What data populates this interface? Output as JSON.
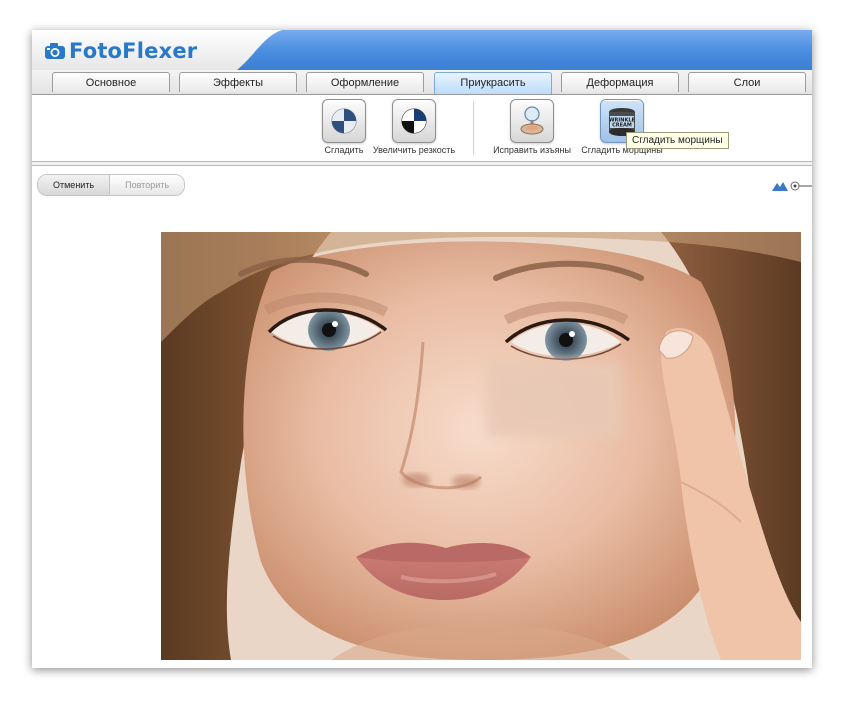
{
  "app": {
    "name": "FotoFlexer"
  },
  "tabs": [
    {
      "label": "Основное"
    },
    {
      "label": "Эффекты"
    },
    {
      "label": "Оформление"
    },
    {
      "label": "Приукрасить",
      "active": true
    },
    {
      "label": "Деформация"
    },
    {
      "label": "Слои"
    }
  ],
  "tools": [
    {
      "label": "Сгладить",
      "icon": "smooth-icon"
    },
    {
      "label": "Увеличить резкость",
      "icon": "sharpen-icon"
    },
    {
      "label": "Исправить изъяны",
      "icon": "blemish-fix-icon"
    },
    {
      "label": "Сгладить морщины",
      "icon": "wrinkle-cream-icon",
      "icon_text": [
        "WRINKLE",
        "CREAM"
      ]
    }
  ],
  "tooltip": {
    "text": "Сгладить морщины"
  },
  "history": {
    "undo_label": "Отменить",
    "redo_label": "Повторить"
  },
  "colors": {
    "brand": "#2a78c8",
    "header_blue": "#4a8fe0",
    "active_tab": "#bcdcfb"
  }
}
